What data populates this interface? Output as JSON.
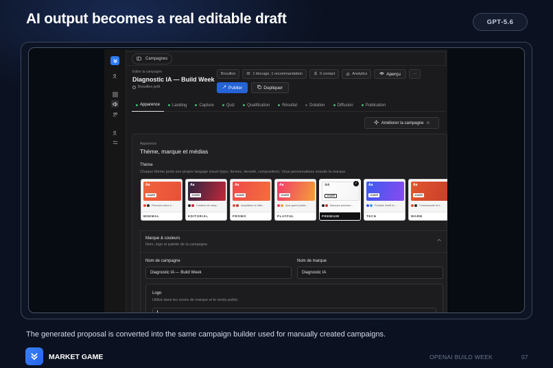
{
  "slide": {
    "title": "AI output becomes a real editable draft",
    "model_badge": "GPT-5.6",
    "caption": "The generated proposal is converted into the same campaign builder used for manually created campaigns.",
    "brand": "MARKET GAME",
    "event": "OPENAI BUILD WEEK",
    "page": "07"
  },
  "app": {
    "topbar": {
      "sidebar_toggle_icon": "panel-left-icon",
      "breadcrumb": "Campagnes"
    },
    "header": {
      "edit_label": "Éditer la campagne",
      "title": "Diagnostic IA — Build Week",
      "status": "Brouillon prêt"
    },
    "chips": {
      "draft": "Brouillon",
      "issues": "1 blocage, 1 recommandation",
      "contacts": "0 contact",
      "analytics": "Analytics",
      "preview": "Aperçu",
      "more": "···"
    },
    "actions": {
      "publish": "Publier",
      "duplicate": "Dupliquer"
    },
    "tabs": [
      {
        "label": "Apparence",
        "status": "ok"
      },
      {
        "label": "Landing",
        "status": "ok"
      },
      {
        "label": "Capture",
        "status": "ok"
      },
      {
        "label": "Quiz",
        "status": "ok"
      },
      {
        "label": "Qualification",
        "status": "ok"
      },
      {
        "label": "Résultat",
        "status": "ok"
      },
      {
        "label": "Dotation",
        "status": "empty"
      },
      {
        "label": "Diffusion",
        "status": "ok"
      },
      {
        "label": "Publication",
        "status": "ok"
      }
    ],
    "improve": {
      "label": "Améliorer la campagne",
      "tag": "IA"
    },
    "panel": {
      "eyebrow": "Apparence",
      "title": "Thème, marque et médias",
      "theme_label": "Thème",
      "theme_desc": "Chaque thème porte son propre langage visuel (typo, formes, densité, composition). Vous personnalisez ensuite la marque.",
      "themes": [
        {
          "name": "MINIMAL",
          "aa": "Aa",
          "button": "JOUER",
          "desc": "Parcours sobre e...",
          "grad": [
            "#f0643c",
            "#e8503a"
          ],
          "sw": [
            "#e8503a",
            "#2a2a2a"
          ]
        },
        {
          "name": "EDITORIAL",
          "aa": "Aa",
          "button": "JOUER",
          "desc": "Contenu de marq...",
          "grad": [
            "#2a2440",
            "#c4283a"
          ],
          "sw": [
            "#222",
            "#c4283a"
          ]
        },
        {
          "name": "PROMO",
          "aa": "Aa",
          "button": "JOUER",
          "desc": "Acquisition et offre...",
          "grad": [
            "#ef4a4a",
            "#f2703c"
          ],
          "sw": [
            "#e8503a",
            "#c43a2a"
          ]
        },
        {
          "name": "PLAYFUL",
          "aa": "Aa",
          "button": "JOUER",
          "desc": "Quiz grand public...",
          "grad": [
            "#ef3a6a",
            "#f4a03a"
          ],
          "sw": [
            "#ef3a6a",
            "#f4a03a"
          ]
        },
        {
          "name": "PREMIUM",
          "aa": "AA",
          "button": "JOUER",
          "desc": "Marques premium...",
          "grad": [
            "#ffffff",
            "#f4f4f4"
          ],
          "sw": [
            "#222",
            "#c43a2a"
          ]
        },
        {
          "name": "TECH",
          "aa": "Aa",
          "button": "JOUER",
          "desc": "Produits SaaS et ...",
          "grad": [
            "#3a5cf0",
            "#8a4af0"
          ],
          "sw": [
            "#3a5cf0",
            "#3a9af0"
          ]
        },
        {
          "name": "WARM",
          "aa": "Aa",
          "button": "JOUER",
          "desc": "Communauté et e...",
          "grad": [
            "#e2552e",
            "#c9402a"
          ],
          "sw": [
            "#e2552e",
            "#2a2a2a"
          ]
        }
      ],
      "selected_theme": "PREMIUM",
      "brand_section": {
        "title": "Marque & couleurs",
        "subtitle": "Nom, logo et palette de la campagne.",
        "campaign_name_label": "Nom de campagne",
        "campaign_name_value": "Diagnostic IA — Build Week",
        "brand_name_label": "Nom de marque",
        "brand_name_value": "Diagnostic IA",
        "logo_title": "Logo",
        "logo_desc": "Utilisé dans les zones de marque et le rendu public."
      }
    }
  },
  "colors": {
    "accent": "#2563d6",
    "ok": "#36c26a",
    "background": "#0b1120"
  }
}
